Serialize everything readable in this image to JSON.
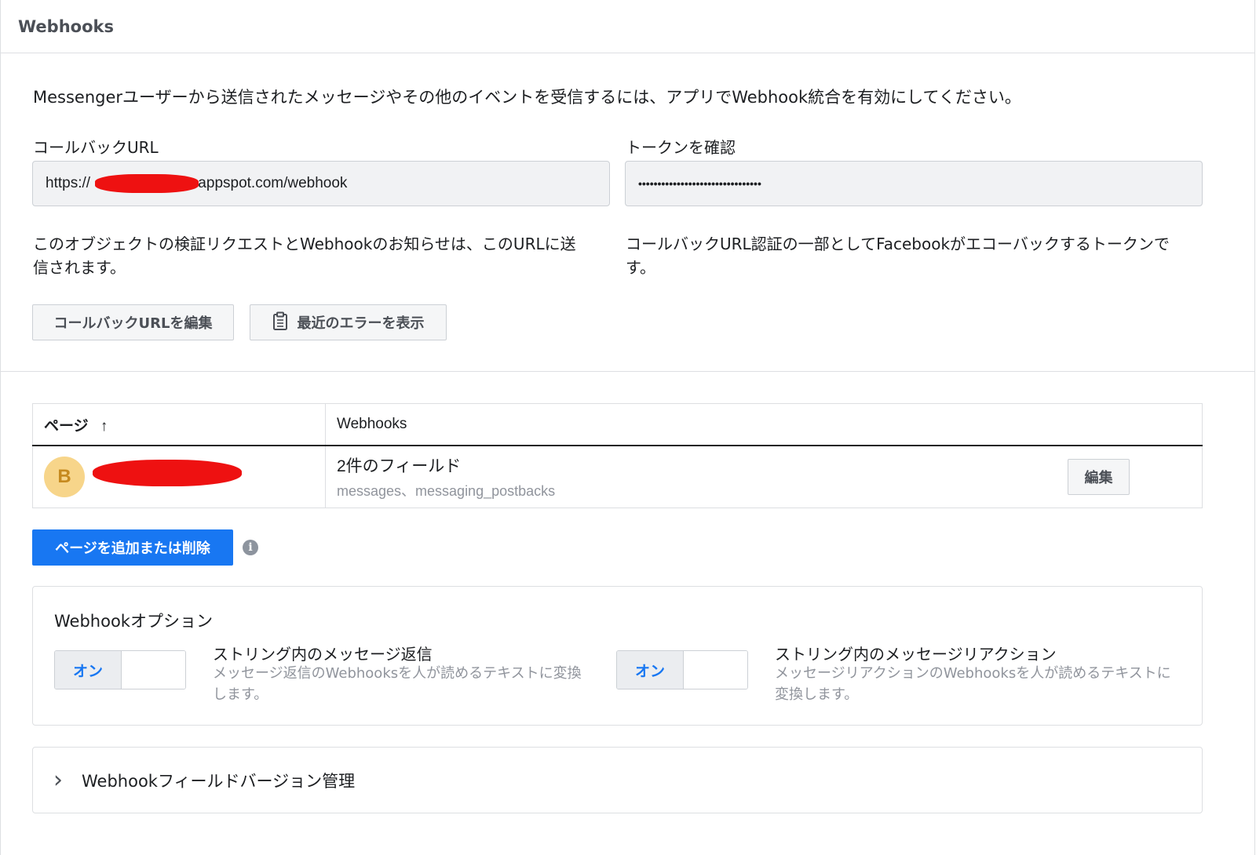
{
  "header": {
    "title": "Webhooks"
  },
  "intro": "Messengerユーザーから送信されたメッセージやその他のイベントを受信するには、アプリでWebhook統合を有効にしてください。",
  "callback": {
    "label": "コールバックURL",
    "value_prefix": "https://",
    "value_suffix": ".appspot.com/webhook",
    "help": "このオブジェクトの検証リクエストとWebhookのお知らせは、このURLに送信されます。"
  },
  "token": {
    "label": "トークンを確認",
    "value": "••••••••••••••••••••••••••••••••",
    "help": "コールバックURL認証の一部としてFacebookがエコーバックするトークンです。"
  },
  "buttons": {
    "edit_callback": "コールバックURLを編集",
    "show_errors": "最近のエラーを表示"
  },
  "table": {
    "col_page": "ページ",
    "col_page_sort": "↑",
    "col_webhooks": "Webhooks",
    "rows": [
      {
        "avatar_letter": "B",
        "fields_title": "2件のフィールド",
        "fields_list": "messages、messaging_postbacks",
        "edit_label": "編集"
      }
    ]
  },
  "add_remove_button": "ページを追加または削除",
  "info_icon": "i",
  "options": {
    "title": "Webhookオプション",
    "items": [
      {
        "toggle_label": "オン",
        "title": "ストリング内のメッセージ返信",
        "desc": "メッセージ返信のWebhooksを人が読めるテキストに変換します。"
      },
      {
        "toggle_label": "オン",
        "title": "ストリング内のメッセージリアクション",
        "desc": "メッセージリアクションのWebhooksを人が読めるテキストに変換します。"
      }
    ]
  },
  "versioning": {
    "label": "Webhookフィールドバージョン管理",
    "chevron": "›"
  },
  "colors": {
    "primary": "#1877f2",
    "avatar_bg": "#f7d58a",
    "redaction": "#ee1111"
  },
  "icons": {
    "clipboard": "clipboard-icon",
    "info": "info-icon",
    "chevron": "chevron-right-icon",
    "sort": "arrow-up-icon"
  }
}
